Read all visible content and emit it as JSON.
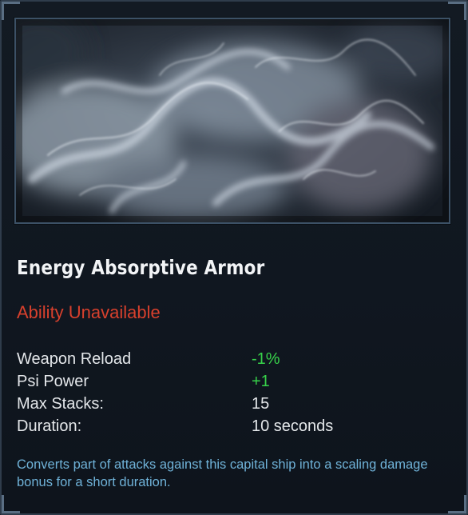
{
  "tooltip": {
    "image": "smoke-artwork",
    "title": "Energy Absorptive Armor",
    "status": "Ability Unavailable",
    "stats": [
      {
        "label": "Weapon Reload",
        "value": "-1%",
        "kind": "positive"
      },
      {
        "label": "Psi Power",
        "value": "+1",
        "kind": "positive"
      },
      {
        "label": "Max Stacks:",
        "value": "15",
        "kind": "neutral"
      },
      {
        "label": "Duration:",
        "value": "10 seconds",
        "kind": "neutral"
      }
    ],
    "description": "Converts part of attacks against this capital ship into a scaling damage bonus for a short duration."
  },
  "colors": {
    "title": "#f2f4f6",
    "status_unavailable": "#d8402d",
    "stat_positive": "#37d24a",
    "stat_neutral": "#e4e7ea",
    "description": "#6fb2d8",
    "frame_border": "#3c5166"
  }
}
